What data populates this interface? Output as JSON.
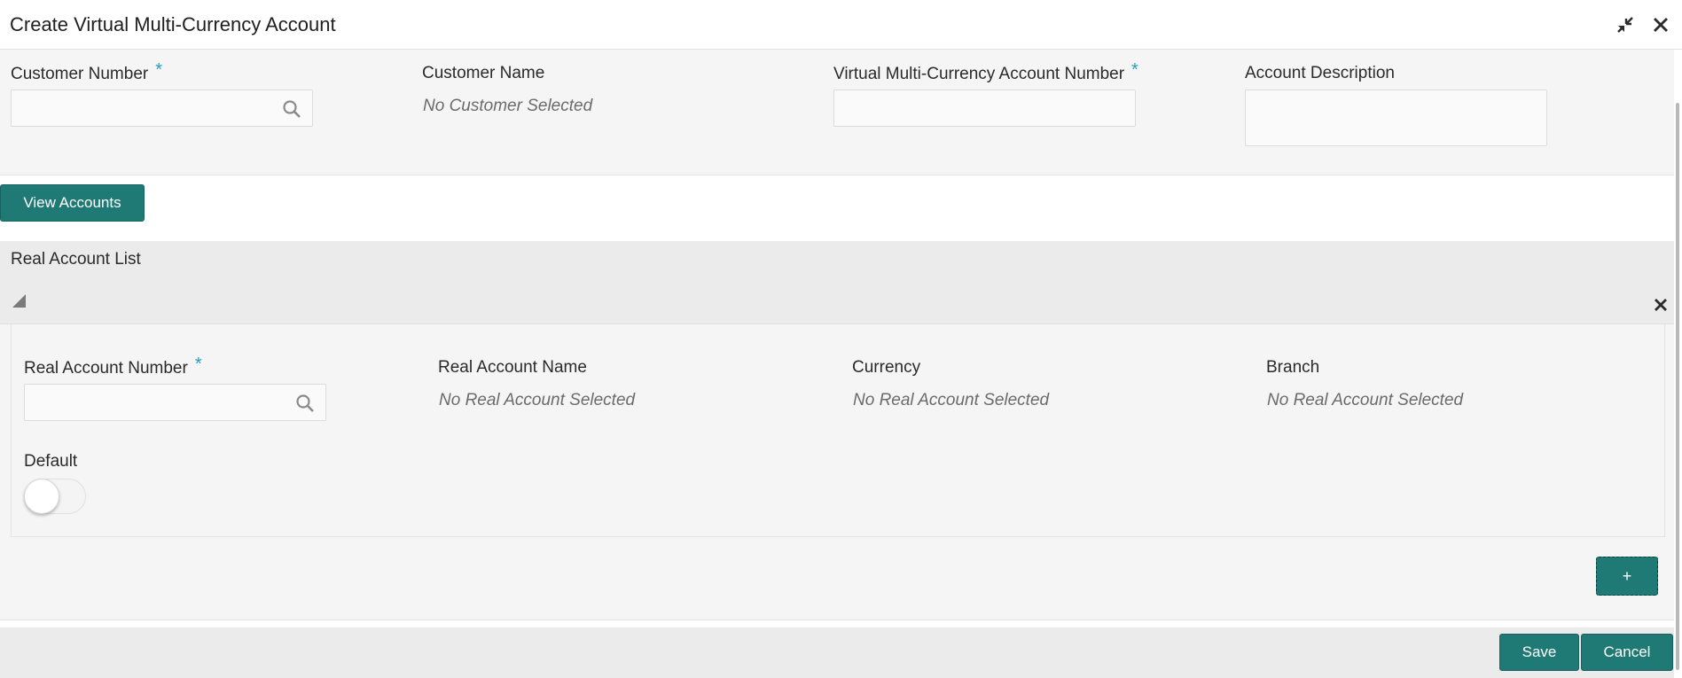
{
  "window": {
    "title": "Create Virtual Multi-Currency Account",
    "icons": {
      "minimize": "minimize-arrows-icon",
      "close": "close-icon"
    }
  },
  "form": {
    "customer_number": {
      "label": "Customer Number",
      "required": "*",
      "value": "",
      "icon": "search-icon"
    },
    "customer_name": {
      "label": "Customer Name",
      "value": "No Customer Selected"
    },
    "vmca_number": {
      "label": "Virtual Multi-Currency Account Number",
      "required": "*",
      "value": ""
    },
    "account_description": {
      "label": "Account Description",
      "value": ""
    }
  },
  "view_accounts_button": "View Accounts",
  "real_account_list": {
    "title": "Real Account List",
    "real_account_number": {
      "label": "Real Account Number",
      "required": "*",
      "value": "",
      "icon": "search-icon"
    },
    "real_account_name": {
      "label": "Real Account Name",
      "value": "No Real Account Selected"
    },
    "currency": {
      "label": "Currency",
      "value": "No Real Account Selected"
    },
    "branch": {
      "label": "Branch",
      "value": "No Real Account Selected"
    },
    "default": {
      "label": "Default",
      "on": false
    },
    "add_button": "+"
  },
  "footer": {
    "save": "Save",
    "cancel": "Cancel"
  },
  "colors": {
    "primary_button": "#1f7a75",
    "required_marker": "#2a9bc6",
    "panel_bg": "#f5f5f5"
  }
}
